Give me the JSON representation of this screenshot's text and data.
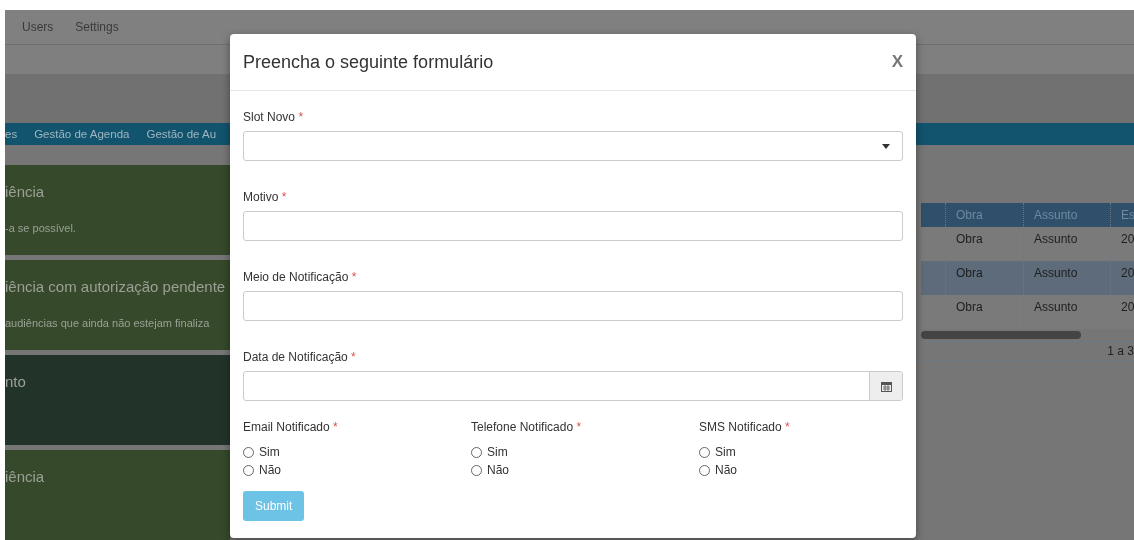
{
  "navbar": {
    "items": [
      "Users",
      "Settings"
    ]
  },
  "tabs_bar": {
    "items": [
      "es",
      "Gestão de Agenda",
      "Gestão de Au"
    ]
  },
  "cards": [
    {
      "title": "iência",
      "text": "-a se possível.",
      "color": "#36492a"
    },
    {
      "title": "iência com autorização pendente",
      "text": "audiências que ainda não estejam finaliza",
      "color": "#36492a"
    },
    {
      "title": "nto",
      "color": "#22332a"
    },
    {
      "title": "iência",
      "color": "#36492a"
    }
  ],
  "table": {
    "columns": [
      "Obra",
      "Assunto",
      "Es"
    ],
    "rows": [
      {
        "cells": [
          "Obra",
          "Assunto",
          "20"
        ],
        "selected": false
      },
      {
        "cells": [
          "Obra",
          "Assunto",
          "20"
        ],
        "selected": true
      },
      {
        "cells": [
          "Obra",
          "Assunto",
          "20"
        ],
        "selected": false
      }
    ],
    "footer": "1 a 3"
  },
  "modal": {
    "title": "Preencha o seguinte formulário",
    "close": "X",
    "required_mark": "*",
    "fields": [
      {
        "label": "Slot Novo",
        "required": true,
        "kind": "select"
      },
      {
        "label": "Motivo",
        "required": true,
        "kind": "text"
      },
      {
        "label": "Meio de Notificação",
        "required": true,
        "kind": "text"
      },
      {
        "label": "Data de Notificação",
        "required": true,
        "kind": "date"
      }
    ],
    "radio_groups": [
      {
        "label": "Email Notificado",
        "required": true,
        "options": [
          {
            "label": "Sim",
            "selected": false
          },
          {
            "label": "Não",
            "selected": false
          }
        ]
      },
      {
        "label": "Telefone Notificado",
        "required": true,
        "options": [
          {
            "label": "Sim",
            "selected": false
          },
          {
            "label": "Não",
            "selected": false
          }
        ]
      },
      {
        "label": "SMS Notificado",
        "required": true,
        "options": [
          {
            "label": "Sim",
            "selected": false
          },
          {
            "label": "Não",
            "selected": false
          }
        ]
      }
    ],
    "submit": {
      "label": "Submit",
      "disabled": true
    }
  }
}
